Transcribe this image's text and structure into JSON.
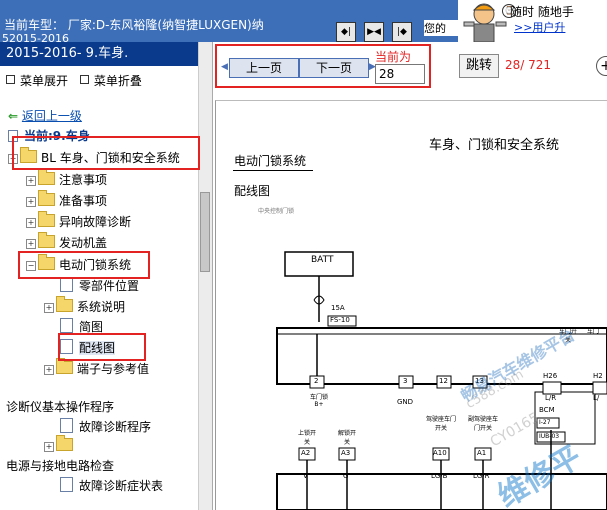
{
  "header": {
    "vehicle_line": "当前车型：  厂家:D-东风裕隆(纳智捷LUXGEN)纳",
    "year_line": "52015-2016",
    "your_text": "您的",
    "ad_line1": "随时 随地手",
    "ad_line2": ">>用户升"
  },
  "tree": {
    "title": "2015-2016- 9.车身.",
    "expand_label": "菜单展开",
    "collapse_label": "菜单折叠",
    "back_label": "返回上一级",
    "current_label": "当前:9.车身",
    "items": [
      {
        "label": "BL 车身、门锁和安全系统"
      },
      {
        "label": "注意事项"
      },
      {
        "label": "准备事项"
      },
      {
        "label": "异响故障诊断"
      },
      {
        "label": "发动机盖"
      },
      {
        "label": "电动门锁系统"
      },
      {
        "label": "零部件位置"
      },
      {
        "label": "系统说明"
      },
      {
        "label": "简图"
      },
      {
        "label": "配线图"
      },
      {
        "label": "端子与参考值"
      },
      {
        "label": "诊断仪基本操作程序"
      },
      {
        "label": "故障诊断程序"
      },
      {
        "label": "电源与接地电路检查"
      },
      {
        "label": "故障诊断症状表"
      }
    ]
  },
  "nav": {
    "prev_label": "上一页",
    "next_label": "下一页",
    "current_label": "当前为",
    "page_value": "28",
    "jump_label": "跳转",
    "page_count": "28/ 721",
    "plus_label": "+"
  },
  "diagram": {
    "doc_title": "车身、门锁和安全系统",
    "section_title": "电动门锁系统",
    "sub_title": "配线图",
    "small_note": "中央控制门锁",
    "batt": "BATT",
    "fuse_rating": "15A",
    "fuse_id": "FS-10",
    "pins_top": [
      "2",
      "3",
      "12",
      "13"
    ],
    "pin_labels_top": [
      "车门锁 B+",
      "GND",
      "",
      ""
    ],
    "side_labels": [
      "车门开关",
      "车门"
    ],
    "bcm": "BCM",
    "bcm_codes": [
      "I-27",
      "IUB-03"
    ],
    "h_pins": [
      "H26",
      "H2"
    ],
    "h_pin_colors": [
      "L/R",
      "L/"
    ],
    "switch_labels": [
      "上锁开关",
      "解锁开关",
      "驾驶座车门开关",
      "副驾驶座车门开关"
    ],
    "bottom_pins": [
      "A2",
      "A3",
      "A10",
      "A1"
    ],
    "bottom_colors": [
      "V",
      "G",
      "LG/B",
      "LG/R"
    ],
    "watermarks": [
      "畅易汽车维修平台",
      "c588.com",
      "CY0165",
      "维修平"
    ]
  }
}
